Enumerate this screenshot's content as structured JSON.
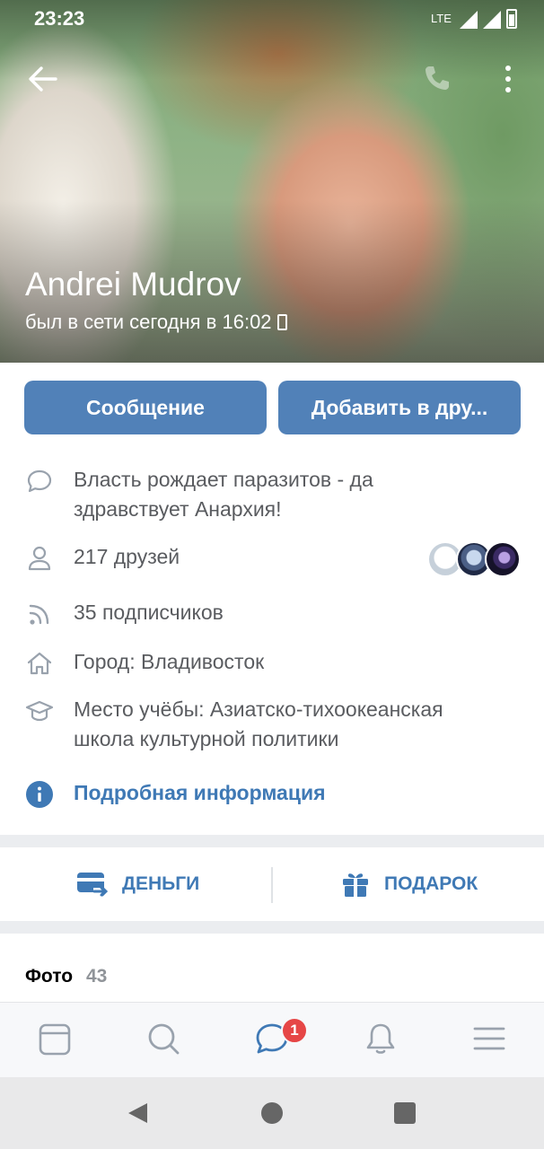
{
  "status_bar": {
    "time": "23:23",
    "network": "LTE"
  },
  "profile": {
    "name": "Andrei Mudrov",
    "last_seen": "был в сети сегодня в 16:02"
  },
  "buttons": {
    "message": "Сообщение",
    "add_friend": "Добавить в дру..."
  },
  "info": {
    "quote": "Власть рождает паразитов - да здравствует Анархия!",
    "friends": "217 друзей",
    "subscribers": "35 подписчиков",
    "city": "Город: Владивосток",
    "education": "Место учёбы: Азиатско-тихоокеанская школа культурной политики",
    "more_link": "Подробная информация"
  },
  "actions": {
    "money": "ДЕНЬГИ",
    "gift": "ПОДАРОК"
  },
  "photos": {
    "title": "Фото",
    "count": "43"
  },
  "tabbar": {
    "messages_badge": "1"
  },
  "colors": {
    "accent": "#5181b8",
    "link": "#3f79b5",
    "badge": "#e64646"
  }
}
